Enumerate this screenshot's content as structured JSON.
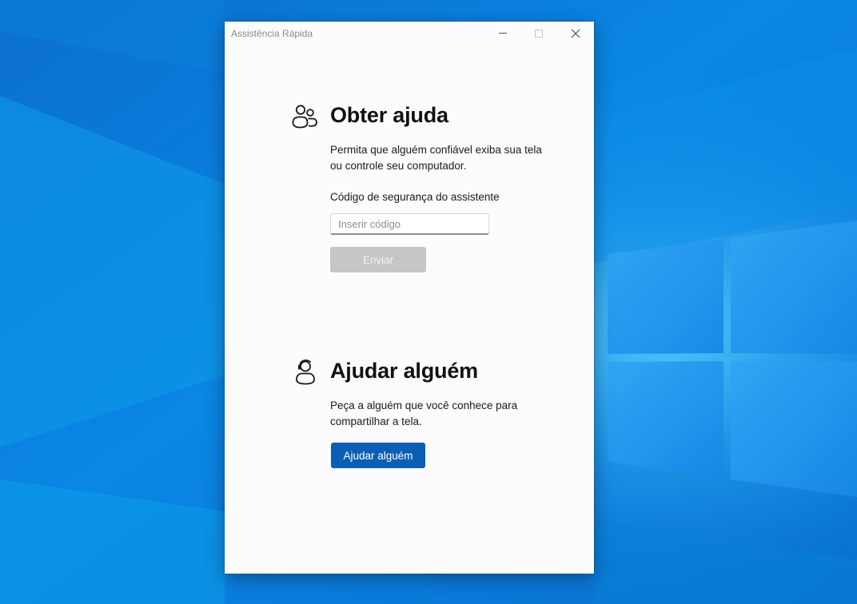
{
  "window": {
    "title": "Assistência Rápida"
  },
  "get_help": {
    "title": "Obter ajuda",
    "description": "Permita que alguém confiável exiba sua tela ou controle seu computador.",
    "code_label": "Código de segurança do assistente",
    "code_placeholder": "Inserir código",
    "code_value": "",
    "submit_label": "Enviar"
  },
  "help_someone": {
    "title": "Ajudar alguém",
    "description": "Peça a alguém que você conhece para compartilhar a tela.",
    "button_label": "Ajudar alguém"
  },
  "icons": {
    "get_help": "people-icon",
    "help_someone": "person-headset-icon",
    "minimize": "minimize-icon",
    "maximize": "maximize-icon",
    "close": "close-icon"
  },
  "colors": {
    "accent": "#0a5fb4",
    "disabled_button": "#c6c6c6",
    "window_background": "#fcfcfc",
    "desktop_background": "#0a78d7"
  }
}
